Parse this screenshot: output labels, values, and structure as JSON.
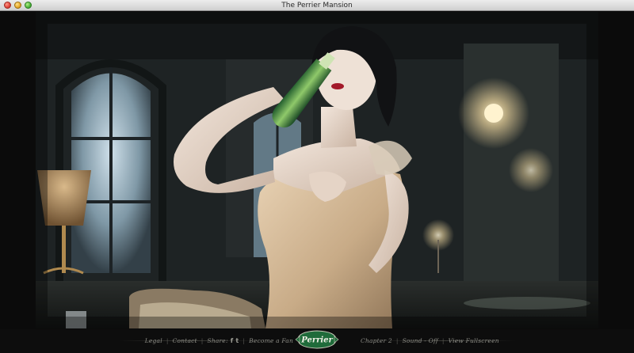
{
  "window": {
    "title": "The Perrier Mansion"
  },
  "footer": {
    "legal": "Legal",
    "contact": "Contact",
    "share_label": "Share:",
    "facebook_glyph": "f",
    "twitter_glyph": "t",
    "become_fan": "Become a Fan",
    "logo_text": "Perrier",
    "chapter": "Chapter 2",
    "sound": "Sound - Off",
    "fullscreen": "View Fullscreen"
  },
  "colors": {
    "logo_green": "#1f6b3a",
    "footer_text": "#8f8f88",
    "background": "#0d0d0d"
  }
}
